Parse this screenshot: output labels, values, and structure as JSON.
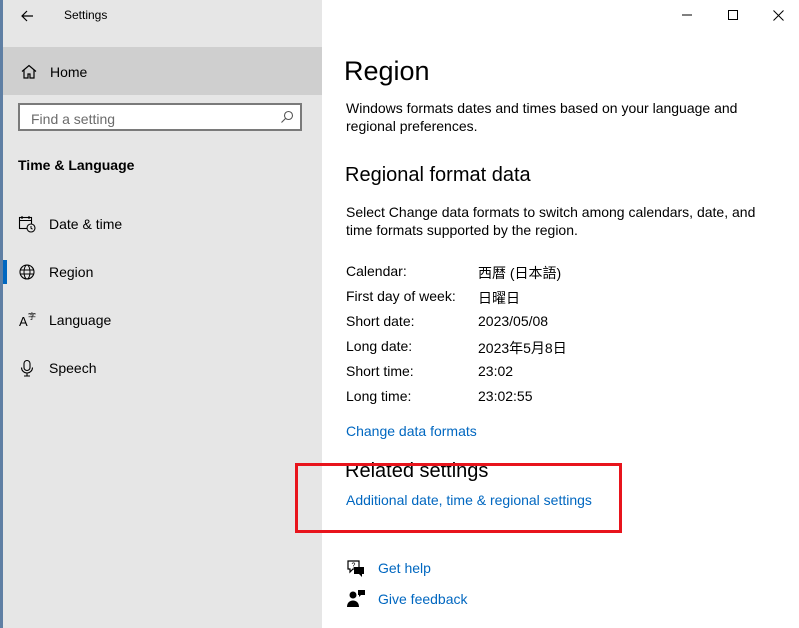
{
  "window": {
    "title": "Settings"
  },
  "sidebar": {
    "home_label": "Home",
    "search_placeholder": "Find a setting",
    "section_title": "Time & Language",
    "items": [
      {
        "label": "Date & time",
        "icon": "calendar-clock-icon"
      },
      {
        "label": "Region",
        "icon": "globe-icon",
        "selected": true
      },
      {
        "label": "Language",
        "icon": "language-icon"
      },
      {
        "label": "Speech",
        "icon": "microphone-icon"
      }
    ]
  },
  "main": {
    "title": "Region",
    "description": "Windows formats dates and times based on your language and regional preferences.",
    "regional_format": {
      "heading": "Regional format data",
      "description": "Select Change data formats to switch among calendars, date, and time formats supported by the region.",
      "rows": [
        {
          "label": "Calendar:",
          "value": "西暦 (日本語)"
        },
        {
          "label": "First day of week:",
          "value": "日曜日"
        },
        {
          "label": "Short date:",
          "value": "2023/05/08"
        },
        {
          "label": "Long date:",
          "value": "2023年5月8日"
        },
        {
          "label": "Short time:",
          "value": "23:02"
        },
        {
          "label": "Long time:",
          "value": "23:02:55"
        }
      ],
      "change_link": "Change data formats"
    },
    "related": {
      "heading": "Related settings",
      "additional_link": "Additional date, time & regional settings"
    },
    "help": {
      "get_help": "Get help",
      "give_feedback": "Give feedback"
    }
  },
  "colors": {
    "accent": "#0067c0",
    "highlight": "#e8141c",
    "sidebar_bg": "#e6e6e6"
  }
}
